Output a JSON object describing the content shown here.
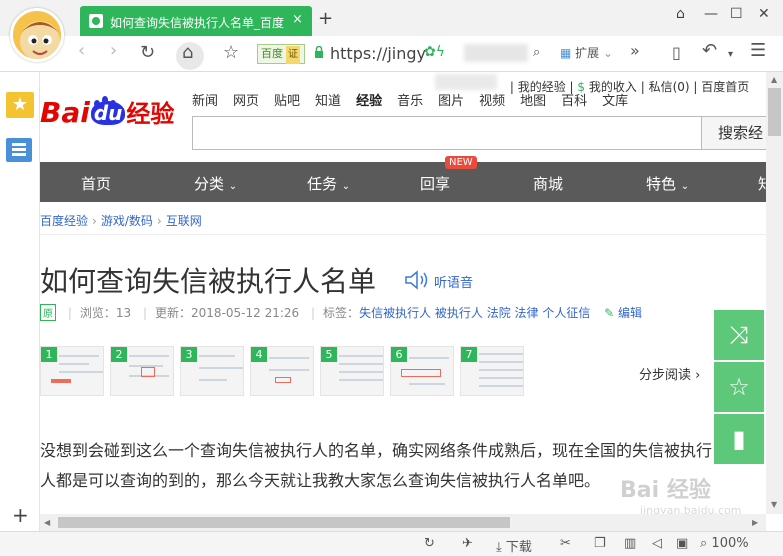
{
  "browser": {
    "tab_title": "如何查询失信被执行人名单_百度",
    "tab_close": "×",
    "new_tab": "+",
    "url_display": "https://jingy",
    "cert_label": "百度",
    "cert_badge": "证",
    "extensions_label": "扩展",
    "more": "»",
    "window": {
      "skin": "⌂",
      "minimize": "—",
      "maximize": "☐",
      "close": "✕"
    }
  },
  "toolbar": {
    "back": "‹",
    "forward": "›",
    "reload": "↻",
    "home": "⌂",
    "favorite": "☆",
    "undo": "↶",
    "menu": "☰"
  },
  "top_links": [
    "我的经验",
    "我的收入",
    "私信(0)",
    "百度首页"
  ],
  "logo": {
    "bai": "Bai",
    "du": "du",
    "jingyan": "经验"
  },
  "top_nav": [
    "新闻",
    "网页",
    "贴吧",
    "知道",
    "经验",
    "音乐",
    "图片",
    "视频",
    "地图",
    "百科",
    "文库"
  ],
  "search": {
    "button": "搜索经"
  },
  "main_nav": [
    "首页",
    "分类",
    "任务",
    "回享",
    "商城",
    "特色",
    "知"
  ],
  "new_badge": "NEW",
  "breadcrumb": [
    "百度经验",
    "游戏/数码",
    "互联网"
  ],
  "article": {
    "title": "如何查询失信被执行人名单",
    "listen": "听语音",
    "original": "原",
    "views": "浏览：13",
    "updated": "更新：2018-05-12 21:26",
    "tags_label": "标签：",
    "tags": "失信被执行人 被执行人 法院 法律 个人征信",
    "edit": "编辑",
    "steps": [
      "1",
      "2",
      "3",
      "4",
      "5",
      "6",
      "7"
    ],
    "step_read": "分步阅读 ›",
    "body_line1": "没想到会碰到这么一个查询失信被执行人的名单，确实网络条件成熟后，现在全国的失信被执行",
    "body_line2": "人都是可以查询的到的，那么今天就让我教大家怎么查询失信被执行人名单吧。"
  },
  "watermark": {
    "text": "Bai 经验",
    "sub": "jingyan.baidu.com"
  },
  "status": {
    "download": "下载",
    "zoom": "100%"
  },
  "colors": {
    "accent": "#2fb65a",
    "nav_bg": "#5a5a5a",
    "float_btn": "#5ec87a",
    "link": "#3366cc"
  }
}
